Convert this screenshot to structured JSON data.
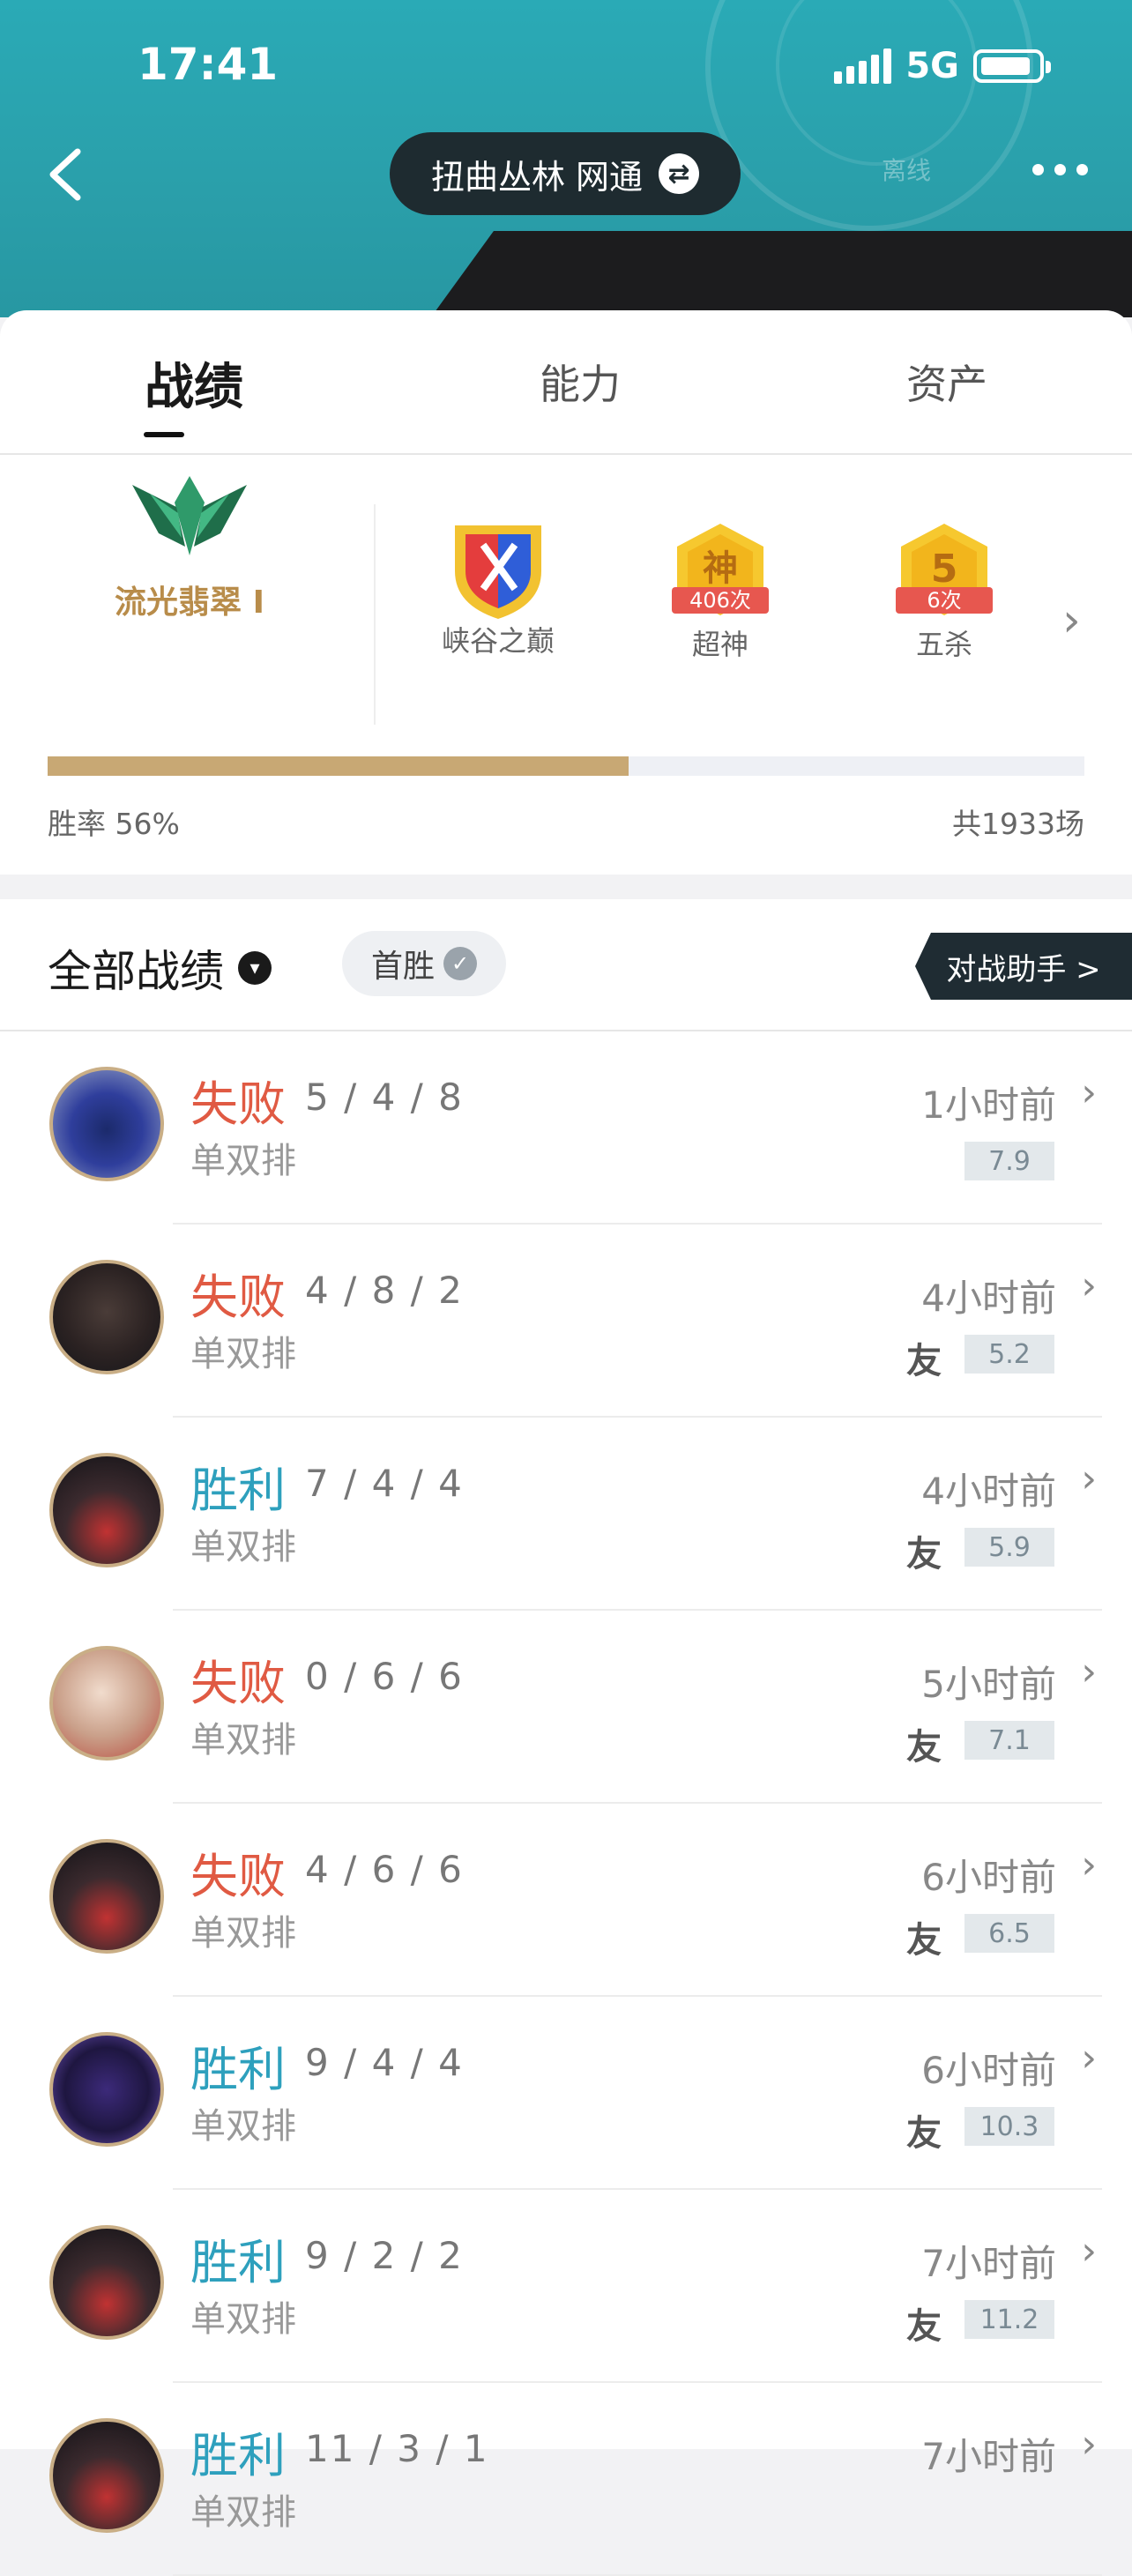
{
  "status_bar": {
    "time": "17:41",
    "network": "5G"
  },
  "header": {
    "server": "扭曲丛林 网通",
    "faint_text": "离线"
  },
  "tabs": [
    {
      "label": "战绩"
    },
    {
      "label": "能力"
    },
    {
      "label": "资产"
    }
  ],
  "rank": {
    "label": "流光翡翠 I"
  },
  "badges": [
    {
      "caption": "峡谷之巅",
      "count": ""
    },
    {
      "caption": "超神",
      "count": "406次",
      "glyph": "神"
    },
    {
      "caption": "五杀",
      "count": "6次",
      "glyph": "5"
    }
  ],
  "stats": {
    "winrate_label": "胜率 56%",
    "winrate": 0.56,
    "total_label": "共1933场"
  },
  "filter": {
    "all_label": "全部战绩",
    "chip_label": "首胜",
    "helper_label": "对战助手 >"
  },
  "matches": [
    {
      "result": "失败",
      "kda": "5 / 4 / 8",
      "mode": "单双排",
      "ago": "1小时前",
      "score": "7.9",
      "friend": "",
      "avatar": "blue"
    },
    {
      "result": "失败",
      "kda": "4 / 8 / 2",
      "mode": "单双排",
      "ago": "4小时前",
      "score": "5.2",
      "friend": "友",
      "avatar": "dark"
    },
    {
      "result": "胜利",
      "kda": "7 / 4 / 4",
      "mode": "单双排",
      "ago": "4小时前",
      "score": "5.9",
      "friend": "友",
      "avatar": "red"
    },
    {
      "result": "失败",
      "kda": "0 / 6 / 6",
      "mode": "单双排",
      "ago": "5小时前",
      "score": "7.1",
      "friend": "友",
      "avatar": "pale"
    },
    {
      "result": "失败",
      "kda": "4 / 6 / 6",
      "mode": "单双排",
      "ago": "6小时前",
      "score": "6.5",
      "friend": "友",
      "avatar": "red"
    },
    {
      "result": "胜利",
      "kda": "9 / 4 / 4",
      "mode": "单双排",
      "ago": "6小时前",
      "score": "10.3",
      "friend": "友",
      "avatar": "purple"
    },
    {
      "result": "胜利",
      "kda": "9 / 2 / 2",
      "mode": "单双排",
      "ago": "7小时前",
      "score": "11.2",
      "friend": "友",
      "avatar": "red"
    },
    {
      "result": "胜利",
      "kda": "11 / 3 / 1",
      "mode": "单双排",
      "ago": "7小时前",
      "score": "",
      "friend": "",
      "avatar": "red"
    }
  ]
}
